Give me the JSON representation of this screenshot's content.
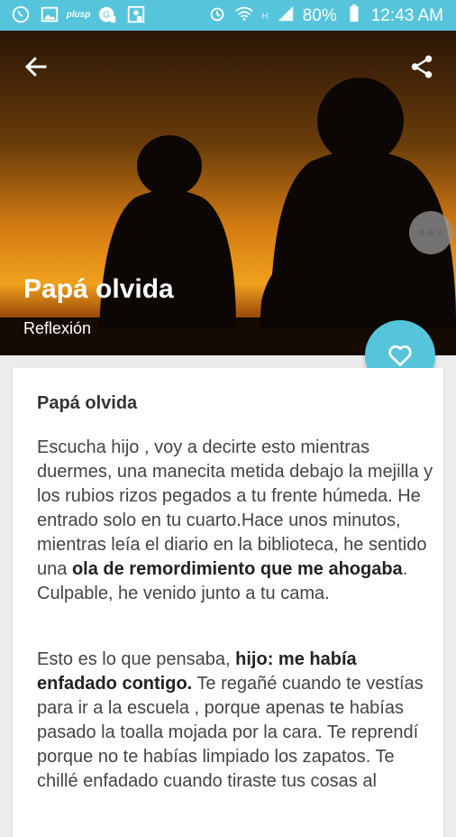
{
  "status_bar": {
    "left_icons": [
      "whatsapp-icon",
      "gallery-icon",
      "plus-text-icon",
      "notification-icon",
      "photo-icon"
    ],
    "plus_text": "plusp",
    "battery_percent": "80%",
    "network_label": "H",
    "time": "12:43 AM"
  },
  "header": {
    "title": "Papá olvida",
    "category": "Reflexión"
  },
  "article": {
    "title": "Papá olvida",
    "p1_a": "Escucha hijo , voy a decirte esto mientras duermes, una manecita metida debajo la mejilla y los rubios rizos pegados a tu frente húmeda. He entrado solo en tu cuarto.Hace unos minutos, mientras leía el diario en la biblioteca, he sentido una ",
    "p1_bold": "ola de remordimiento que me ahogaba",
    "p1_b": ". Culpable, he venido junto a tu cama.",
    "p2_a": "Esto es lo que pensaba, ",
    "p2_bold": "hijo: me había enfadado contigo.",
    "p2_b": " Te regañé cuando te vestías para ir a la escuela , porque apenas te habías pasado la toalla mojada por la cara. Te reprendí porque no te habías limpiado los zapatos. Te chillé enfadado cuando tiraste tus cosas al"
  },
  "colors": {
    "accent": "#56c5dc",
    "card_bg": "#ffffff",
    "page_bg": "#ececec"
  }
}
